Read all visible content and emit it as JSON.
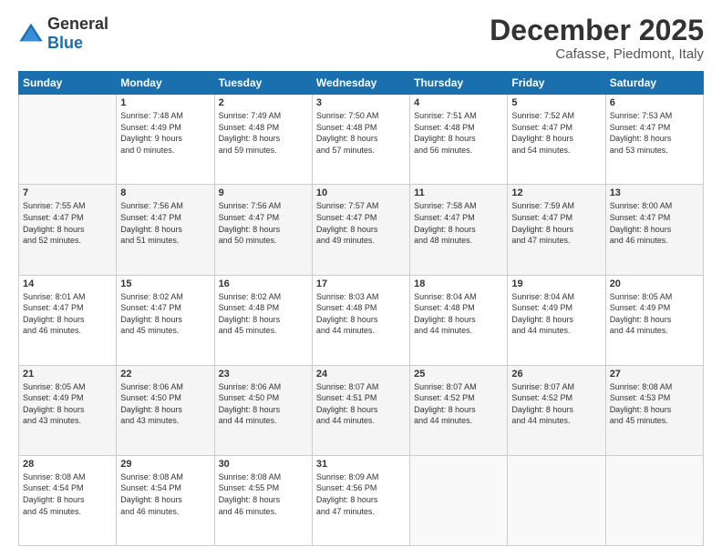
{
  "logo": {
    "text_general": "General",
    "text_blue": "Blue"
  },
  "title": {
    "month": "December 2025",
    "location": "Cafasse, Piedmont, Italy"
  },
  "headers": [
    "Sunday",
    "Monday",
    "Tuesday",
    "Wednesday",
    "Thursday",
    "Friday",
    "Saturday"
  ],
  "weeks": [
    [
      {
        "day": "",
        "info": ""
      },
      {
        "day": "1",
        "info": "Sunrise: 7:48 AM\nSunset: 4:49 PM\nDaylight: 9 hours\nand 0 minutes."
      },
      {
        "day": "2",
        "info": "Sunrise: 7:49 AM\nSunset: 4:48 PM\nDaylight: 8 hours\nand 59 minutes."
      },
      {
        "day": "3",
        "info": "Sunrise: 7:50 AM\nSunset: 4:48 PM\nDaylight: 8 hours\nand 57 minutes."
      },
      {
        "day": "4",
        "info": "Sunrise: 7:51 AM\nSunset: 4:48 PM\nDaylight: 8 hours\nand 56 minutes."
      },
      {
        "day": "5",
        "info": "Sunrise: 7:52 AM\nSunset: 4:47 PM\nDaylight: 8 hours\nand 54 minutes."
      },
      {
        "day": "6",
        "info": "Sunrise: 7:53 AM\nSunset: 4:47 PM\nDaylight: 8 hours\nand 53 minutes."
      }
    ],
    [
      {
        "day": "7",
        "info": "Sunrise: 7:55 AM\nSunset: 4:47 PM\nDaylight: 8 hours\nand 52 minutes."
      },
      {
        "day": "8",
        "info": "Sunrise: 7:56 AM\nSunset: 4:47 PM\nDaylight: 8 hours\nand 51 minutes."
      },
      {
        "day": "9",
        "info": "Sunrise: 7:56 AM\nSunset: 4:47 PM\nDaylight: 8 hours\nand 50 minutes."
      },
      {
        "day": "10",
        "info": "Sunrise: 7:57 AM\nSunset: 4:47 PM\nDaylight: 8 hours\nand 49 minutes."
      },
      {
        "day": "11",
        "info": "Sunrise: 7:58 AM\nSunset: 4:47 PM\nDaylight: 8 hours\nand 48 minutes."
      },
      {
        "day": "12",
        "info": "Sunrise: 7:59 AM\nSunset: 4:47 PM\nDaylight: 8 hours\nand 47 minutes."
      },
      {
        "day": "13",
        "info": "Sunrise: 8:00 AM\nSunset: 4:47 PM\nDaylight: 8 hours\nand 46 minutes."
      }
    ],
    [
      {
        "day": "14",
        "info": "Sunrise: 8:01 AM\nSunset: 4:47 PM\nDaylight: 8 hours\nand 46 minutes."
      },
      {
        "day": "15",
        "info": "Sunrise: 8:02 AM\nSunset: 4:47 PM\nDaylight: 8 hours\nand 45 minutes."
      },
      {
        "day": "16",
        "info": "Sunrise: 8:02 AM\nSunset: 4:48 PM\nDaylight: 8 hours\nand 45 minutes."
      },
      {
        "day": "17",
        "info": "Sunrise: 8:03 AM\nSunset: 4:48 PM\nDaylight: 8 hours\nand 44 minutes."
      },
      {
        "day": "18",
        "info": "Sunrise: 8:04 AM\nSunset: 4:48 PM\nDaylight: 8 hours\nand 44 minutes."
      },
      {
        "day": "19",
        "info": "Sunrise: 8:04 AM\nSunset: 4:49 PM\nDaylight: 8 hours\nand 44 minutes."
      },
      {
        "day": "20",
        "info": "Sunrise: 8:05 AM\nSunset: 4:49 PM\nDaylight: 8 hours\nand 44 minutes."
      }
    ],
    [
      {
        "day": "21",
        "info": "Sunrise: 8:05 AM\nSunset: 4:49 PM\nDaylight: 8 hours\nand 43 minutes."
      },
      {
        "day": "22",
        "info": "Sunrise: 8:06 AM\nSunset: 4:50 PM\nDaylight: 8 hours\nand 43 minutes."
      },
      {
        "day": "23",
        "info": "Sunrise: 8:06 AM\nSunset: 4:50 PM\nDaylight: 8 hours\nand 44 minutes."
      },
      {
        "day": "24",
        "info": "Sunrise: 8:07 AM\nSunset: 4:51 PM\nDaylight: 8 hours\nand 44 minutes."
      },
      {
        "day": "25",
        "info": "Sunrise: 8:07 AM\nSunset: 4:52 PM\nDaylight: 8 hours\nand 44 minutes."
      },
      {
        "day": "26",
        "info": "Sunrise: 8:07 AM\nSunset: 4:52 PM\nDaylight: 8 hours\nand 44 minutes."
      },
      {
        "day": "27",
        "info": "Sunrise: 8:08 AM\nSunset: 4:53 PM\nDaylight: 8 hours\nand 45 minutes."
      }
    ],
    [
      {
        "day": "28",
        "info": "Sunrise: 8:08 AM\nSunset: 4:54 PM\nDaylight: 8 hours\nand 45 minutes."
      },
      {
        "day": "29",
        "info": "Sunrise: 8:08 AM\nSunset: 4:54 PM\nDaylight: 8 hours\nand 46 minutes."
      },
      {
        "day": "30",
        "info": "Sunrise: 8:08 AM\nSunset: 4:55 PM\nDaylight: 8 hours\nand 46 minutes."
      },
      {
        "day": "31",
        "info": "Sunrise: 8:09 AM\nSunset: 4:56 PM\nDaylight: 8 hours\nand 47 minutes."
      },
      {
        "day": "",
        "info": ""
      },
      {
        "day": "",
        "info": ""
      },
      {
        "day": "",
        "info": ""
      }
    ]
  ]
}
